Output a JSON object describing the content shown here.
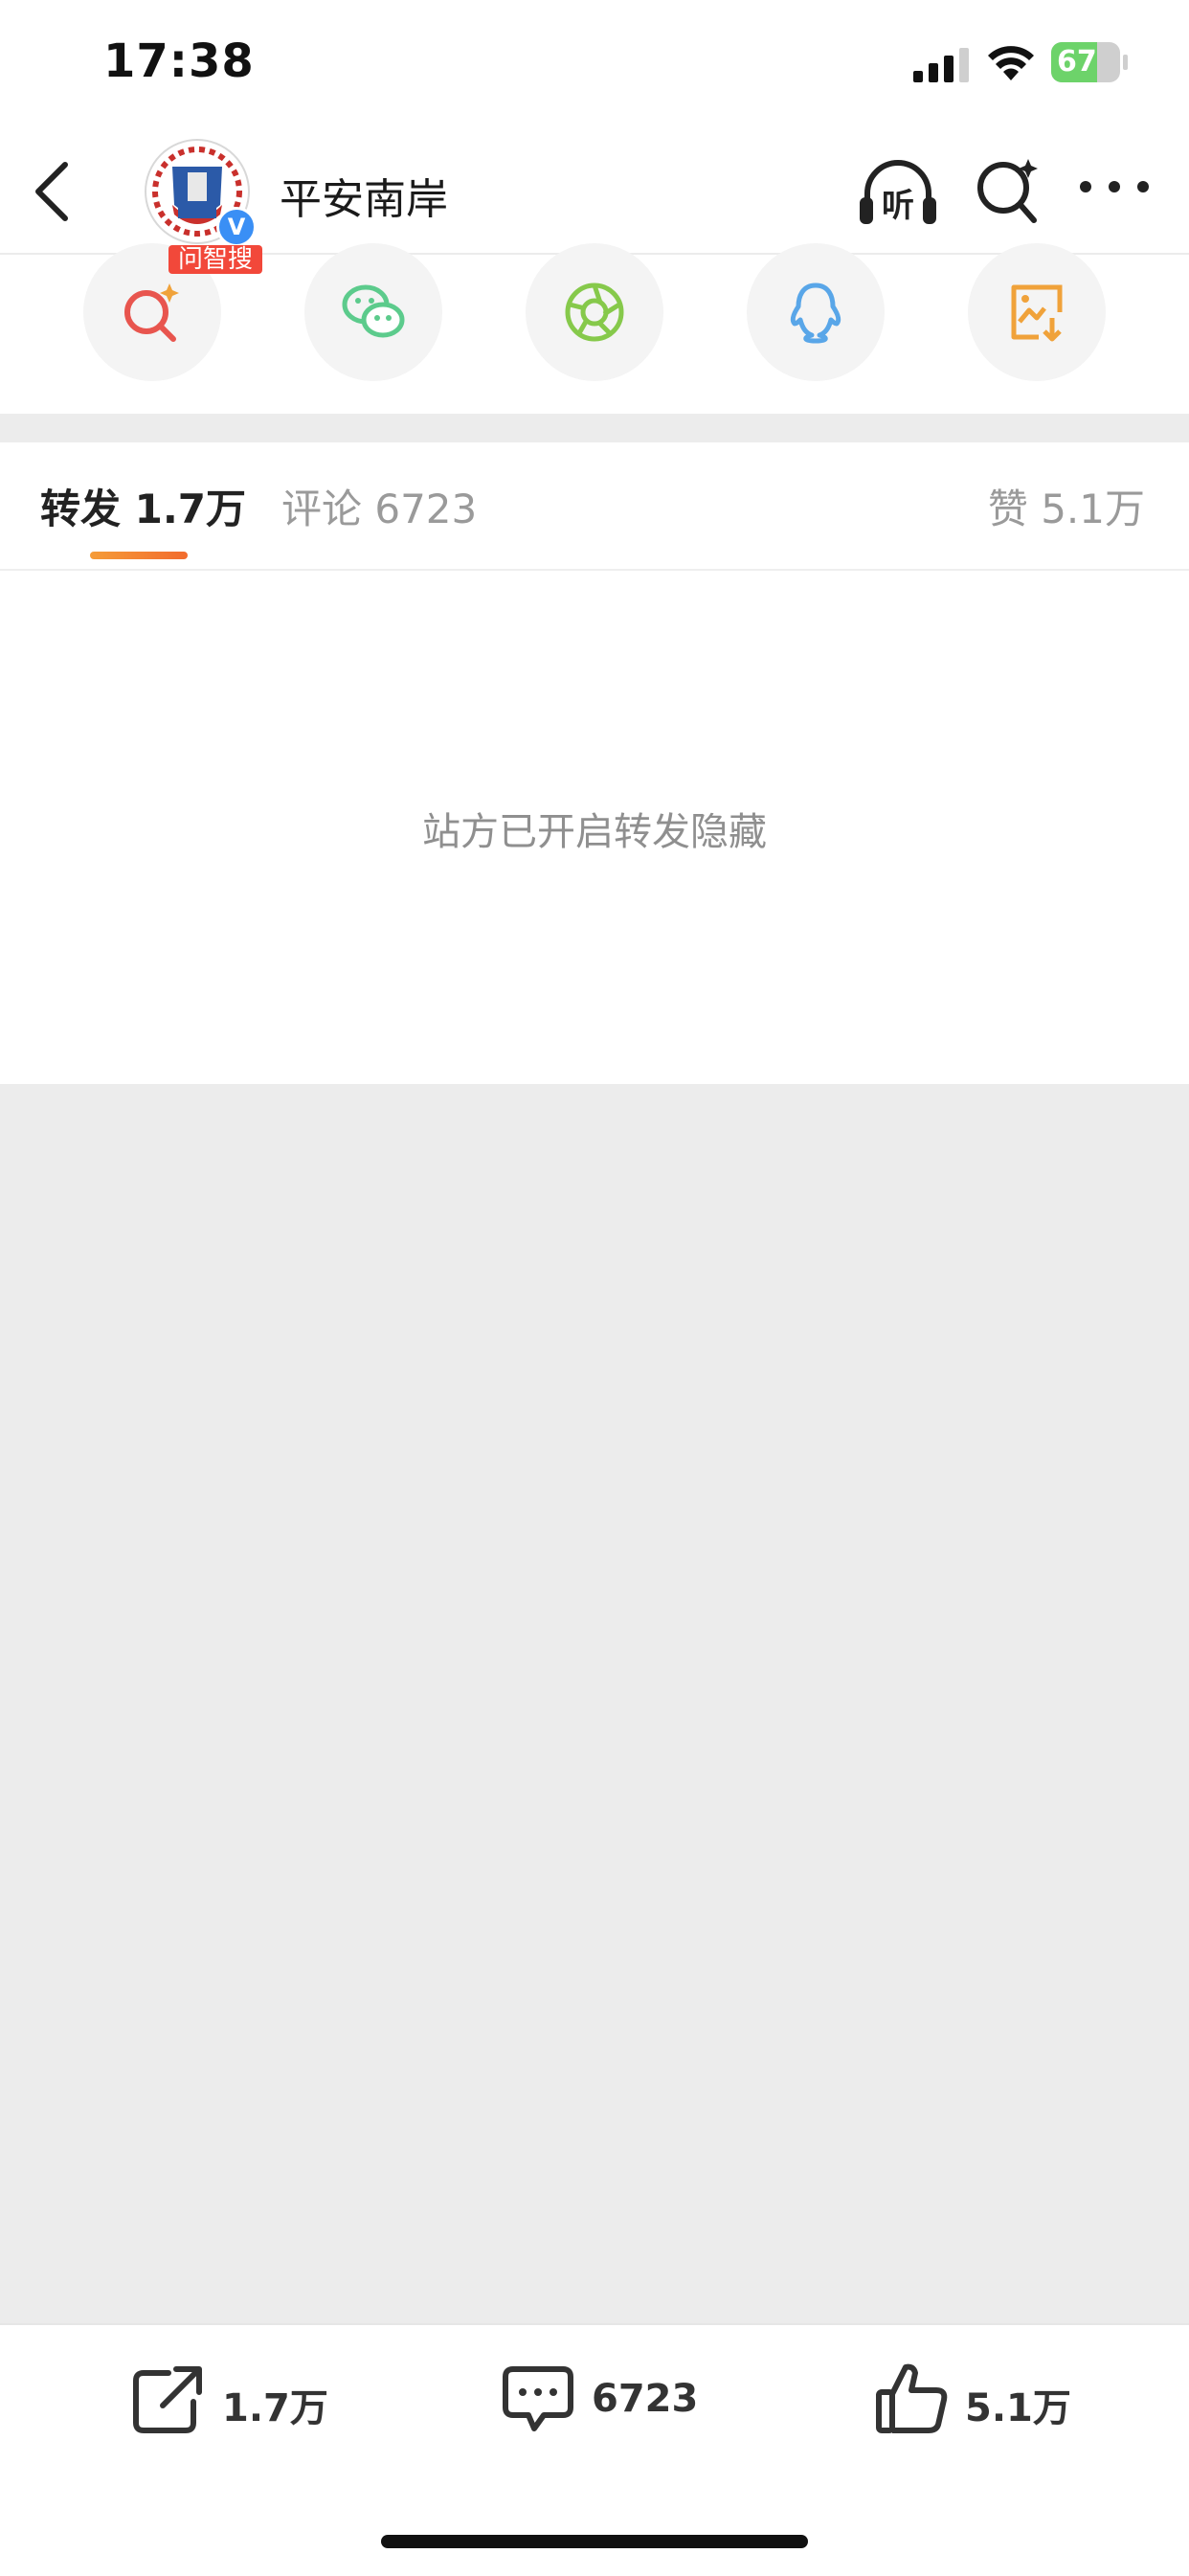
{
  "status_bar": {
    "time": "17:38",
    "battery": "67",
    "battery_level": 0.67
  },
  "nav": {
    "title": "平安南岸",
    "listen_label": "听",
    "verified_badge": "V"
  },
  "share": {
    "tag": "问智搜",
    "items": [
      "zhisou-search-icon",
      "wechat-icon",
      "moments-icon",
      "qq-icon",
      "save-image-icon"
    ]
  },
  "tabs": [
    {
      "label": "转发 1.7万"
    },
    {
      "label": "评论 6723"
    },
    {
      "label": "赞 5.1万"
    }
  ],
  "notice": "站方已开启转发隐藏",
  "bottom": {
    "repost": "1.7万",
    "comment": "6723",
    "like": "5.1万"
  },
  "colors": {
    "accent_orange": "#f26b2d",
    "tag_red": "#f2483a",
    "verified_blue": "#3a8ff5",
    "wechat_green": "#5ccb8c",
    "moments_green": "#86c94b",
    "qq_blue": "#59a6e8",
    "save_orange": "#f0a23a",
    "search_red": "#e8554e"
  }
}
